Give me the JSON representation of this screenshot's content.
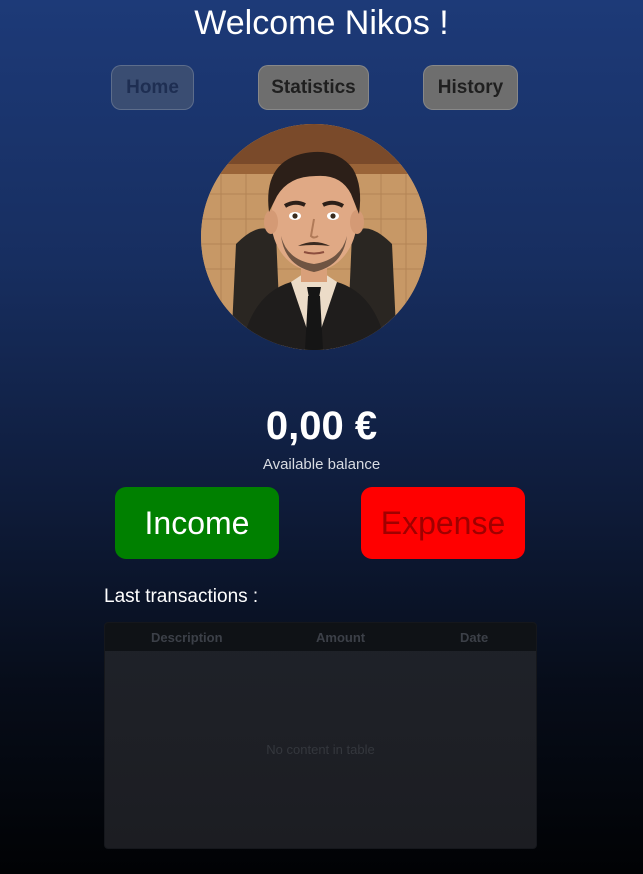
{
  "header": {
    "title": "Welcome Nikos !"
  },
  "nav": {
    "home": "Home",
    "statistics": "Statistics",
    "history": "History"
  },
  "balance": {
    "amount": "0,00 €",
    "label": "Available balance"
  },
  "actions": {
    "income": "Income",
    "expense": "Expense"
  },
  "transactions": {
    "heading": "Last transactions :",
    "columns": [
      "Description",
      "Amount",
      "Date"
    ],
    "rows": [],
    "empty_message": "No content in table"
  },
  "colors": {
    "income": "#008000",
    "expense": "#ff0000",
    "nav_active": "#3a4d72",
    "nav_inactive": "#6e6e6e"
  }
}
